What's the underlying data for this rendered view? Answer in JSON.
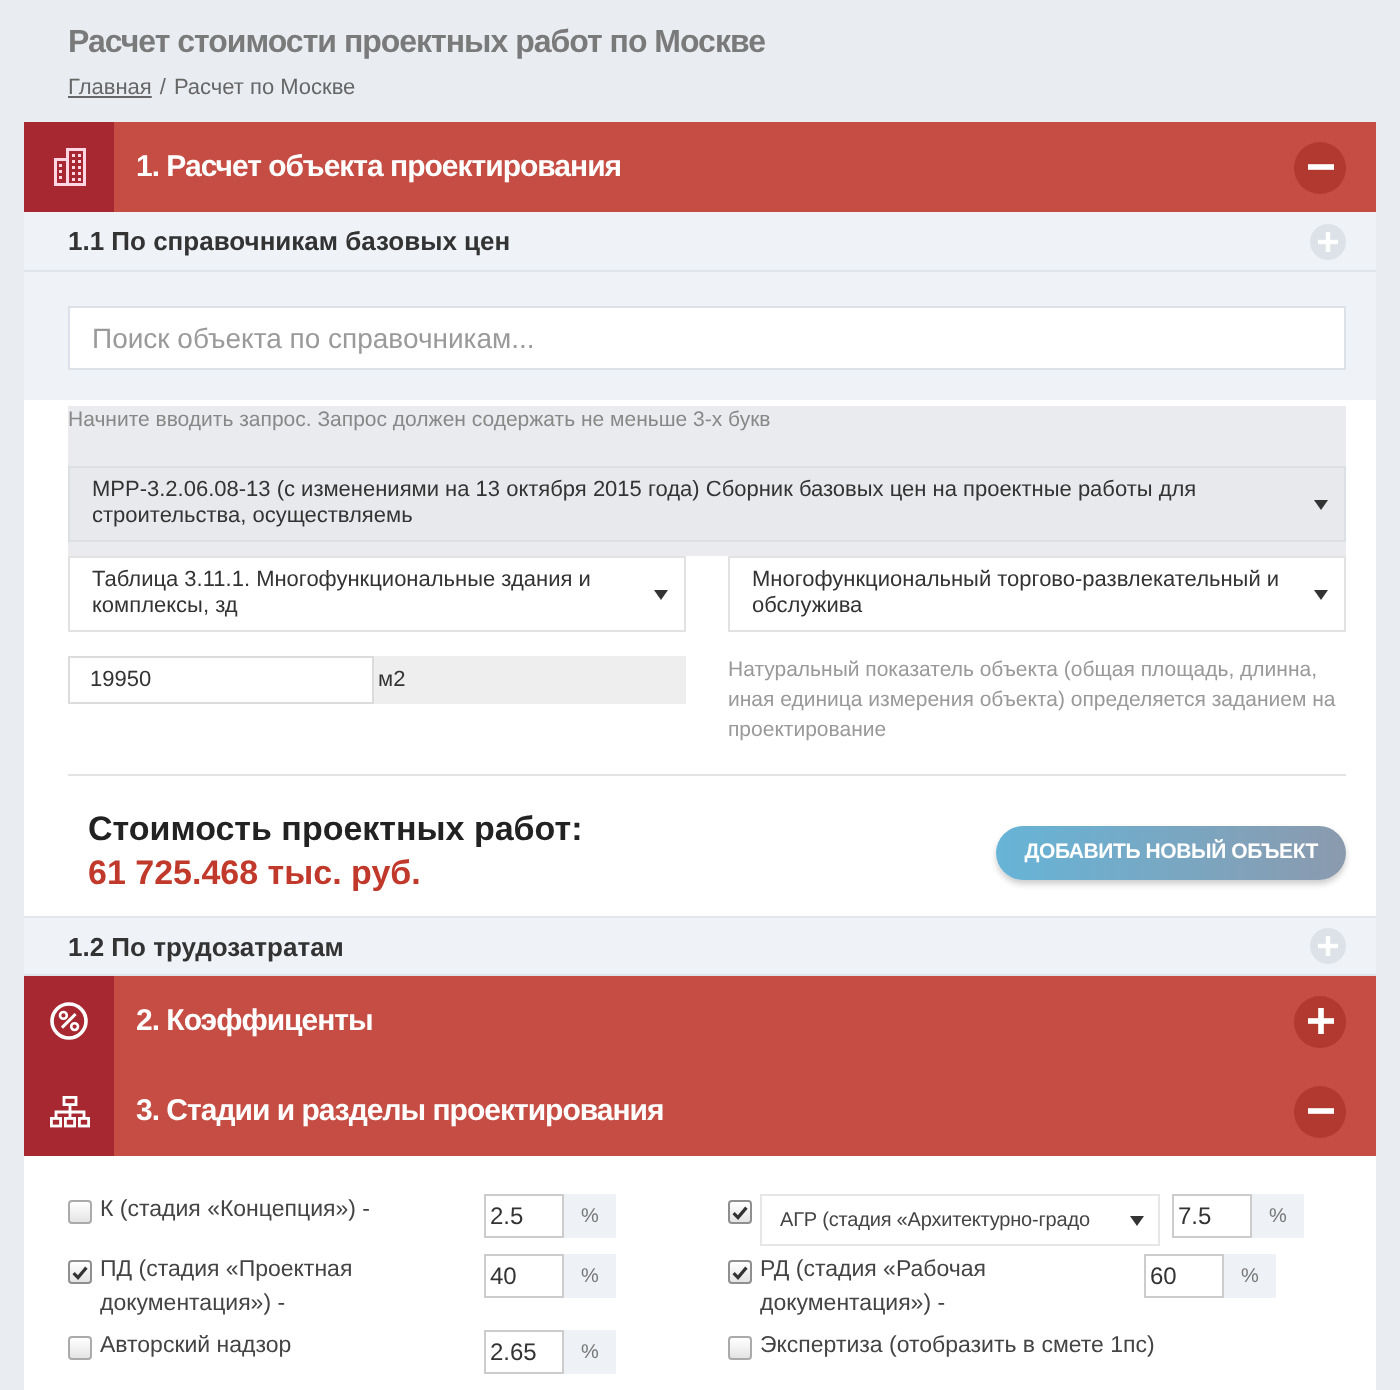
{
  "header": {
    "title": "Расчет стоимости проектных работ по Москве",
    "breadcrumb": {
      "link": "Главная",
      "separator": "/",
      "current": "Расчет по Москве"
    }
  },
  "sections": [
    {
      "title": "1. Расчет объекта проектирования",
      "expanded": true,
      "subsections": [
        {
          "title": "1.1 По справочникам базовых цен",
          "search": {
            "placeholder": "Поиск объекта по справочникам..."
          },
          "hint": "Начните вводить запрос. Запрос должен содержать не меньше 3-х букв",
          "reference_select": "МРР-3.2.06.08-13 (с изменениями на 13 октября 2015 года) Сборник базовых цен на проектные работы для строительства, осуществляемь",
          "table_select": "Таблица 3.11.1. Многофункциональные здания и комплексы, зд",
          "object_select": "Многофункциональный торгово-развлекательный и обслужива",
          "quantity": {
            "value": "19950",
            "unit": "м2"
          },
          "quantity_note": "Натуральный показатель объекта (общая площадь, длинна, иная единица измерения объекта) определяется заданием на проектирование",
          "total": {
            "label": "Стоимость проектных работ:",
            "value": "61 725.468 тыс. руб."
          },
          "add_button": "ДОБАВИТЬ НОВЫЙ ОБЪЕКТ"
        },
        {
          "title": "1.2 По трудозатратам"
        }
      ]
    },
    {
      "title": "2. Коэффиценты",
      "expanded": false
    },
    {
      "title": "3. Стадии и разделы проектирования",
      "expanded": true,
      "stages": [
        {
          "kind": "text",
          "label": "К (стадия «Концепция») -",
          "checked": false,
          "percent": "2.5",
          "unit": "%"
        },
        {
          "kind": "select",
          "label": "АГР (стадия «Архитектурно-градо",
          "checked": true,
          "percent": "7.5",
          "unit": "%"
        },
        {
          "kind": "text",
          "label": "ПД (стадия «Проектная документация») -",
          "checked": true,
          "percent": "40",
          "unit": "%"
        },
        {
          "kind": "text",
          "label": "РД (стадия «Рабочая документация») -",
          "checked": true,
          "percent": "60",
          "unit": "%"
        },
        {
          "kind": "text",
          "label": "Авторский надзор",
          "checked": false,
          "percent": "2.65",
          "unit": "%"
        },
        {
          "kind": "text",
          "label": "Экспертиза (отобразить в смете 1пс)",
          "checked": false
        }
      ]
    }
  ]
}
